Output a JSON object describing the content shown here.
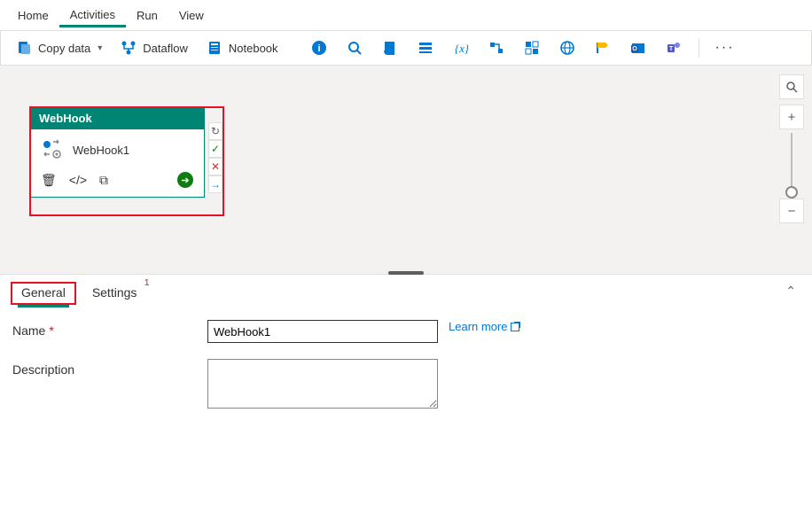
{
  "top_menu": {
    "home": "Home",
    "activities": "Activities",
    "run": "Run",
    "view": "View"
  },
  "toolbar": {
    "copy_data": "Copy data",
    "dataflow": "Dataflow",
    "notebook": "Notebook",
    "more": "···"
  },
  "node": {
    "type_label": "WebHook",
    "name": "WebHook1"
  },
  "side_icons": {
    "retry": "↻",
    "ok": "✓",
    "fail": "✕",
    "next": "→"
  },
  "tabs": {
    "general": "General",
    "settings": "Settings",
    "settings_badge": "1"
  },
  "form": {
    "name_label": "Name",
    "name_value": "WebHook1",
    "desc_label": "Description",
    "desc_value": "",
    "learn_more": "Learn more"
  }
}
